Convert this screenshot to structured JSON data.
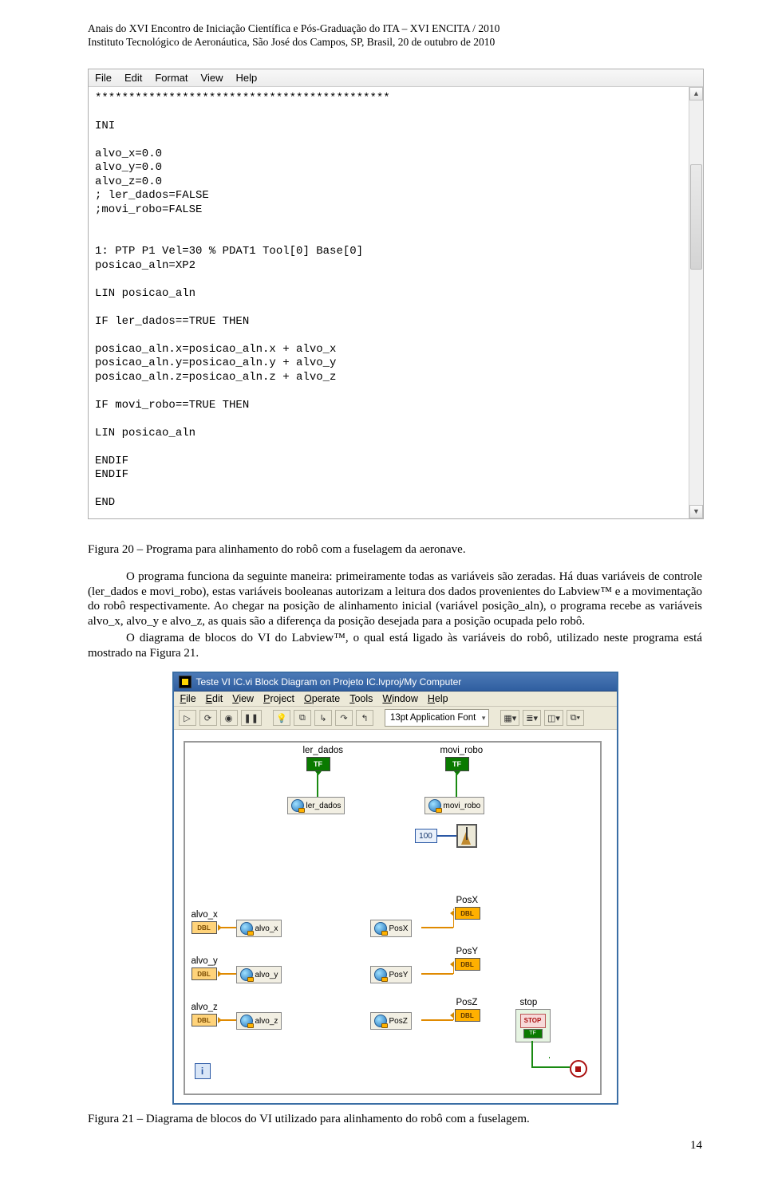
{
  "header": {
    "line1": "Anais do XVI Encontro de Iniciação Científica e Pós-Graduação do ITA – XVI  ENCITA / 2010",
    "line2": "Instituto Tecnológico de Aeronáutica, São José dos Campos, SP, Brasil, 20 de outubro de  2010"
  },
  "notepad": {
    "menu": {
      "file": "File",
      "edit": "Edit",
      "format": "Format",
      "view": "View",
      "help": "Help"
    },
    "code": "********************************************\n\nINI\n\nalvo_x=0.0\nalvo_y=0.0\nalvo_z=0.0\n; ler_dados=FALSE\n;movi_robo=FALSE\n\n\n1: PTP P1 Vel=30 % PDAT1 Tool[0] Base[0]\nposicao_aln=XP2\n\nLIN posicao_aln\n\nIF ler_dados==TRUE THEN\n\nposicao_aln.x=posicao_aln.x + alvo_x\nposicao_aln.y=posicao_aln.y + alvo_y\nposicao_aln.z=posicao_aln.z + alvo_z\n\nIF movi_robo==TRUE THEN\n\nLIN posicao_aln\n\nENDIF\nENDIF\n\nEND"
  },
  "caption1": "Figura 20 – Programa para alinhamento do robô com a fuselagem da aeronave.",
  "para1": "O programa funciona da seguinte maneira: primeiramente todas as variáveis são zeradas. Há duas variáveis de controle (ler_dados e movi_robo), estas variáveis booleanas autorizam a leitura dos dados provenientes do Labview™ e a movimentação do robô respectivamente. Ao chegar na posição de alinhamento inicial (variável posição_aln), o programa recebe as variáveis alvo_x, alvo_y e alvo_z, as quais são a diferença da posição desejada para a posição ocupada pelo robô.",
  "para2": "O diagrama de blocos do VI do Labview™, o qual está ligado às variáveis do robô, utilizado neste programa está mostrado na Figura 21.",
  "labview": {
    "title": "Teste VI IC.vi Block Diagram on Projeto IC.lvproj/My Computer",
    "menu": {
      "file": "File",
      "edit": "Edit",
      "view": "View",
      "project": "Project",
      "operate": "Operate",
      "tools": "Tools",
      "window": "Window",
      "help": "Help"
    },
    "font": "13pt Application Font",
    "labels": {
      "ler_dados": "ler_dados",
      "movi_robo": "movi_robo",
      "alvo_x": "alvo_x",
      "alvo_y": "alvo_y",
      "alvo_z": "alvo_z",
      "PosX": "PosX",
      "PosY": "PosY",
      "PosZ": "PosZ",
      "stop": "stop"
    },
    "nodes": {
      "ler_dados": "ler_dados",
      "movi_robo": "movi_robo",
      "alvo_x": "alvo_x",
      "alvo_y": "alvo_y",
      "alvo_z": "alvo_z",
      "PosX": "PosX",
      "PosY": "PosY",
      "PosZ": "PosZ"
    },
    "const100": "100",
    "tf": "TF",
    "dbl": "DBL",
    "stop_text": "STOP",
    "info": "i"
  },
  "caption2": "Figura 21 – Diagrama de blocos do VI utilizado para alinhamento do robô com a fuselagem.",
  "pagenum": "14"
}
